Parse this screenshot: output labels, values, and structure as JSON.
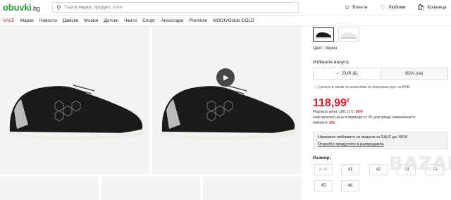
{
  "header": {
    "logo": "obuvki",
    "logo_suffix": ".bg",
    "search_placeholder": "Търси марка, продукт, стил",
    "login": "Влезте",
    "favorites": "Любими",
    "cart": "Кошница"
  },
  "nav": [
    "SALE",
    "Марки",
    "Новости",
    "Дамски",
    "Мъжки",
    "Детски",
    "Чанти",
    "Спорт",
    "Аксесоари",
    "Premium",
    "MODIVOclub GOLD"
  ],
  "product": {
    "color_label": "Цвят: Черен",
    "currency_prompt": "Изберете валута:",
    "currency_eur": "EUR (€)",
    "currency_bgn": "BGN (лв)",
    "rate_note": "Цената в лвове се изчислява по фиксиран курс на БНБ.",
    "price": "118,99",
    "price_currency": "€",
    "regular_price_label": "Редовна цена:",
    "regular_price": "186,11 €",
    "regular_discount": "-36%",
    "lowest_note": "Най-ниската цена в периода от 30 дни преди намалението:",
    "lowest_price": "130,99 €",
    "lowest_discount": "-9%",
    "promo_text": "Намерете любимите си модели на SALE до -50%!",
    "promo_link": "Открийте продуктите в разпродажба",
    "sizes_label": "Размер:",
    "sizes": [
      "40",
      "41",
      "42",
      "43",
      "44",
      "45",
      "46"
    ]
  },
  "watermark": "BAZAR",
  "colors": {
    "brand_green": "#2b9a3e",
    "sale_red": "#d01f2b",
    "text": "#222222"
  }
}
